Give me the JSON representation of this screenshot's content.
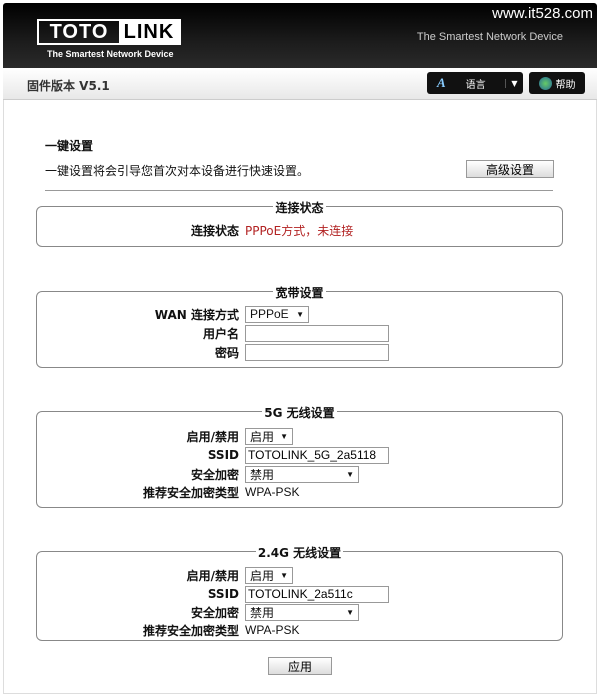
{
  "header": {
    "logo_left": "TOTO",
    "logo_right": "LINK",
    "logo_tagline": "The Smartest Network Device",
    "watermark": "www.it528.com",
    "tagline": "The Smartest Network Device"
  },
  "bar": {
    "firmware": "固件版本 V5.1",
    "language": "语言",
    "help": "帮助"
  },
  "intro": {
    "title": "一键设置",
    "description": "一键设置将会引导您首次对本设备进行快速设置。",
    "advanced": "高级设置"
  },
  "status": {
    "legend": "连接状态",
    "label": "连接状态",
    "value": "PPPoE方式，未连接",
    "value_color": "#b22222"
  },
  "broadband": {
    "legend": "宽带设置",
    "wan_label": "WAN 连接方式",
    "wan_value": "PPPoE",
    "user_label": "用户名",
    "user_value": "",
    "pass_label": "密码",
    "pass_value": ""
  },
  "wifi5g": {
    "legend": "5G 无线设置",
    "enable_label": "启用/禁用",
    "enable_value": "启用",
    "ssid_label": "SSID",
    "ssid_value": "TOTOLINK_5G_2a5118",
    "sec_label": "安全加密",
    "sec_value": "禁用",
    "rec_label": "推荐安全加密类型",
    "rec_value": "WPA-PSK"
  },
  "wifi24": {
    "legend": "2.4G 无线设置",
    "enable_label": "启用/禁用",
    "enable_value": "启用",
    "ssid_label": "SSID",
    "ssid_value": "TOTOLINK_2a511c",
    "sec_label": "安全加密",
    "sec_value": "禁用",
    "rec_label": "推荐安全加密类型",
    "rec_value": "WPA-PSK"
  },
  "apply": "应用"
}
